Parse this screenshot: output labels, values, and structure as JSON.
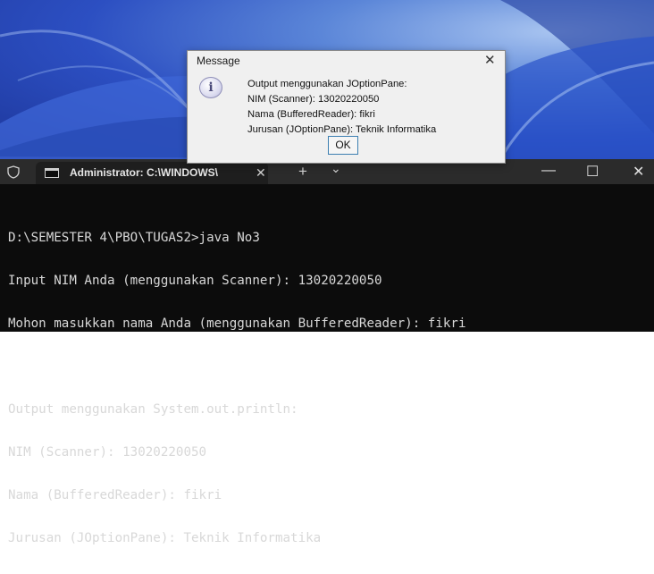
{
  "dialog": {
    "title": "Message",
    "icon": "information-icon",
    "lines": [
      "Output menggunakan JOptionPane:",
      "NIM (Scanner): 13020220050",
      "Nama (BufferedReader): fikri",
      "Jurusan (JOptionPane): Teknik Informatika"
    ],
    "ok_label": "OK"
  },
  "terminal": {
    "tab_title": "Administrator: C:\\WINDOWS\\",
    "lines": [
      "D:\\SEMESTER 4\\PBO\\TUGAS2>java No3",
      "Input NIM Anda (menggunakan Scanner): 13020220050",
      "Mohon masukkan nama Anda (menggunakan BufferedReader): fikri",
      "",
      "Output menggunakan System.out.println:",
      "NIM (Scanner): 13020220050",
      "Nama (BufferedReader): fikri",
      "Jurusan (JOptionPane): Teknik Informatika"
    ]
  },
  "colors": {
    "terminal_bg": "#0c0c0c",
    "titlebar_bg": "#2b2b2b",
    "wallpaper_accent": "#2c4fc2"
  }
}
